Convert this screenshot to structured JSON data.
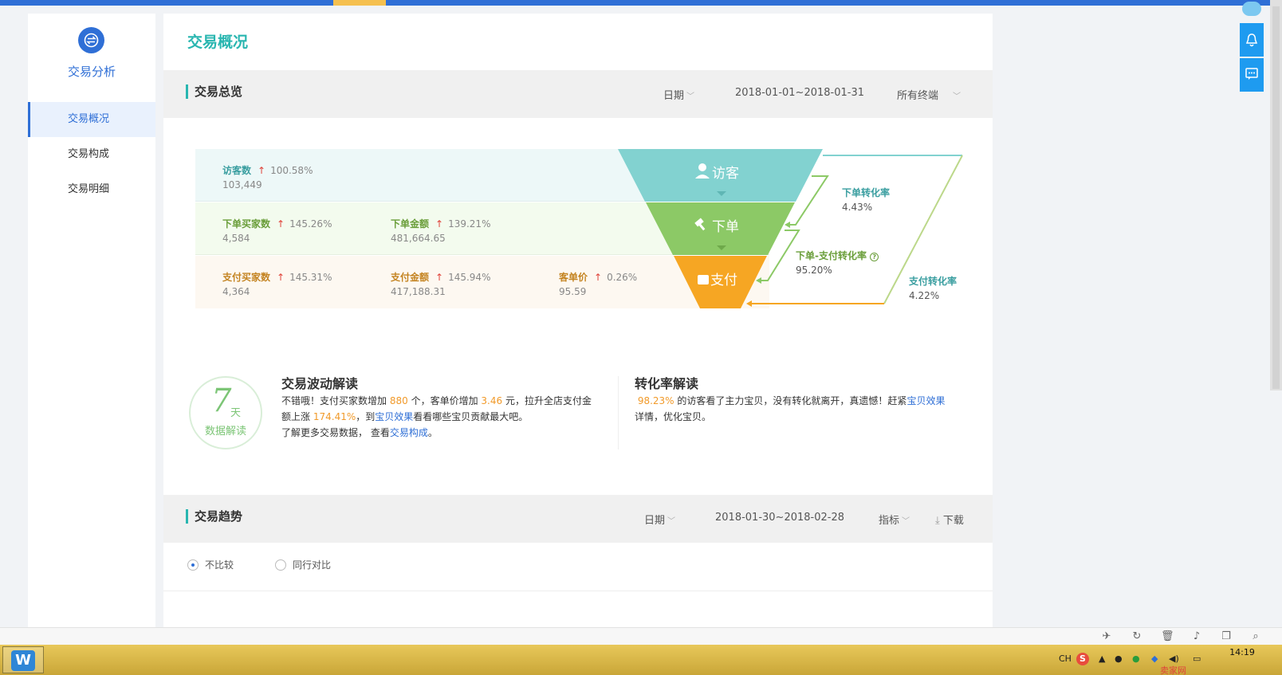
{
  "sidebar": {
    "title": "交易分析",
    "items": [
      {
        "label": "交易概况",
        "active": true
      },
      {
        "label": "交易构成",
        "active": false
      },
      {
        "label": "交易明细",
        "active": false
      }
    ]
  },
  "page_title": "交易概况",
  "overview": {
    "section_title": "交易总览",
    "date_filter": "日期",
    "date_range": "2018-01-01~2018-01-31",
    "terminal_filter": "所有终端",
    "rows": {
      "visitors": {
        "label": "访客数",
        "pct": "100.58%",
        "value": "103,449"
      },
      "order_buyers": {
        "label": "下单买家数",
        "pct": "145.26%",
        "value": "4,584"
      },
      "order_amount": {
        "label": "下单金额",
        "pct": "139.21%",
        "value": "481,664.65"
      },
      "pay_buyers": {
        "label": "支付买家数",
        "pct": "145.31%",
        "value": "4,364"
      },
      "pay_amount": {
        "label": "支付金额",
        "pct": "145.94%",
        "value": "417,188.31"
      },
      "unit_price": {
        "label": "客单价",
        "pct": "0.26%",
        "value": "95.59"
      }
    },
    "funnel": {
      "visitor": "访客",
      "order": "下单",
      "pay": "支付"
    },
    "conversions": {
      "order_rate": {
        "label": "下单转化率",
        "value": "4.43%"
      },
      "order_pay_rate": {
        "label": "下单-支付转化率",
        "value": "95.20%"
      },
      "pay_rate": {
        "label": "支付转化率",
        "value": "4.22%"
      }
    },
    "colors": {
      "visitor": "#82d2d0",
      "order": "#8cc966",
      "pay": "#f6a623"
    }
  },
  "interpretation": {
    "badge_num": "7",
    "badge_unit": "天",
    "badge_sub": "数据解读",
    "wave": {
      "title": "交易波动解读",
      "t1": "不错哦！支付买家数增加",
      "n1": "880",
      "t2": "个，客单价增加",
      "n2": "3.46",
      "t3": "元，拉升全店支付金额上涨",
      "n3": "174.41%",
      "t4": "，到",
      "link1": "宝贝效果",
      "t5": "看看哪些宝贝贡献最大吧。",
      "t6": "了解更多交易数据，  查看",
      "link2": "交易构成",
      "t7": "。"
    },
    "conv": {
      "title": "转化率解读",
      "n1": "98.23%",
      "t1": "的访客看了主力宝贝，没有转化就离开，真遗憾！赶紧",
      "link1": "宝贝效果",
      "t2": "详情，优化宝贝。"
    }
  },
  "trend": {
    "section_title": "交易趋势",
    "date_filter": "日期",
    "date_range": "2018-01-30~2018-02-28",
    "metric_filter": "指标",
    "download": "下载",
    "radio_none": "不比较",
    "radio_peer": "同行对比"
  },
  "taskbar": {
    "lang": "CH",
    "time": "14:19",
    "watermark": "卖家网"
  }
}
